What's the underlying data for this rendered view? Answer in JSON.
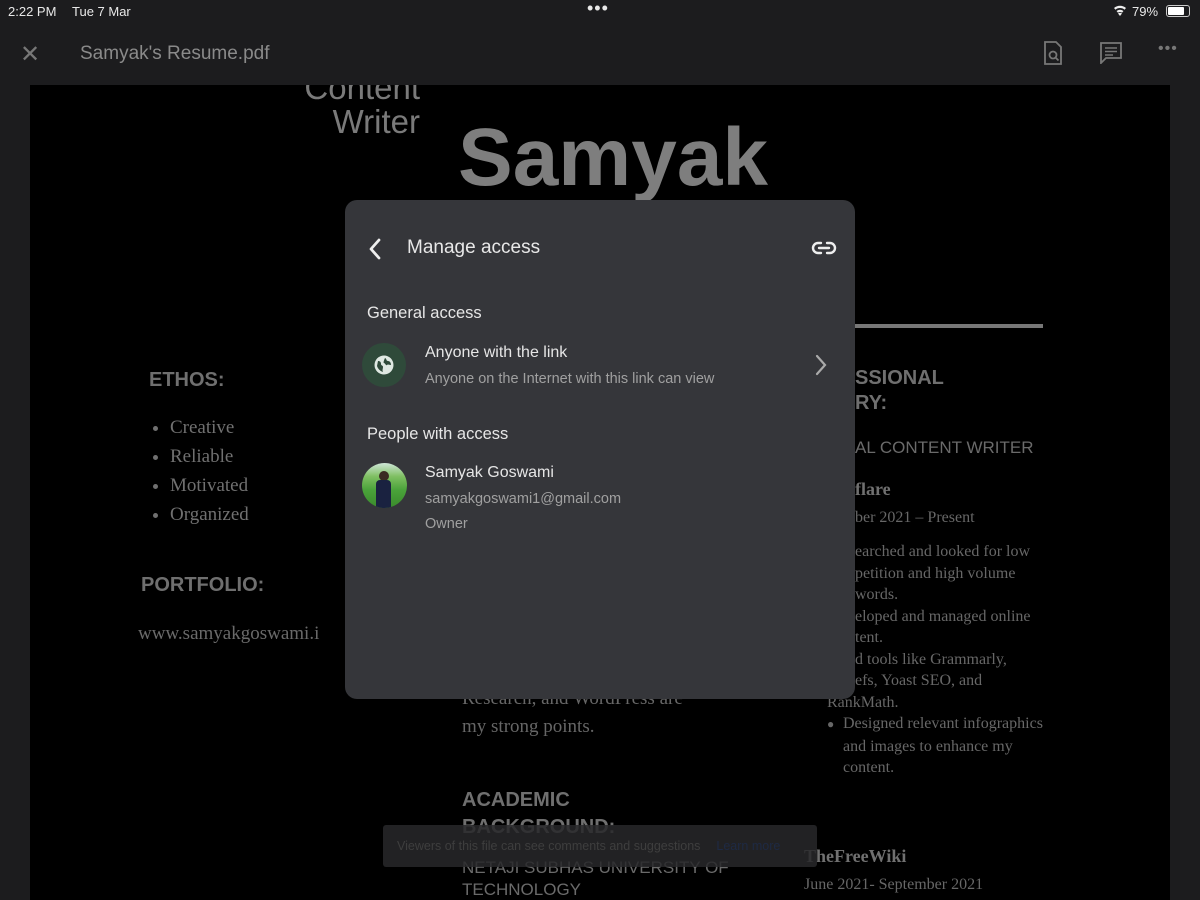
{
  "status_bar": {
    "time": "2:22 PM",
    "date": "Tue 7 Mar",
    "battery": "79%",
    "battery_level": 0.79
  },
  "toolbar": {
    "title": "Samyak's Resume.pdf"
  },
  "document": {
    "role_line1": "Content",
    "role_line2": "Writer",
    "name": "Samyak",
    "ethos_heading": "ETHOS:",
    "ethos": [
      "Creative",
      "Reliable",
      "Motivated",
      "Organized"
    ],
    "portfolio_heading": "PORTFOLIO:",
    "portfolio_url": "www.samyakgoswami.i",
    "middle": {
      "line1": "Research, and WordPress are",
      "line2": "my strong points.",
      "academic_heading1": "ACADEMIC",
      "academic_heading2": "BACKGROUND:",
      "school1": "NETAJI SUBHAS UNIVERSITY OF",
      "school2": "TECHNOLOGY"
    },
    "right": {
      "heading1": "SSIONAL",
      "heading2": "RY:",
      "job_title": "AL CONTENT WRITER",
      "company": "flare",
      "dates": "ber 2021 – Present",
      "bullets": [
        "earched and looked for low",
        "petition and high volume",
        "words.",
        "eloped and managed online",
        "tent.",
        "d tools like Grammarly,",
        "efs, Yoast SEO, and",
        "RankMath."
      ],
      "bullet_full": [
        "Designed relevant infographics",
        "and images to enhance my",
        "content."
      ],
      "company2": "TheFreeWiki",
      "dates2": "June 2021- September 2021"
    }
  },
  "dialog": {
    "title": "Manage access",
    "general_heading": "General access",
    "general_title": "Anyone with the link",
    "general_desc": "Anyone on the Internet with this link can view",
    "people_heading": "People with access",
    "people": [
      {
        "name": "Samyak Goswami",
        "email": "samyakgoswami1@gmail.com",
        "role": "Owner"
      }
    ]
  },
  "toast": {
    "text": "Viewers of this file can see comments and suggestions",
    "link": "Learn more"
  },
  "colors": {
    "dialog_bg": "#35363a",
    "globe_bg": "#2f4a3a"
  }
}
